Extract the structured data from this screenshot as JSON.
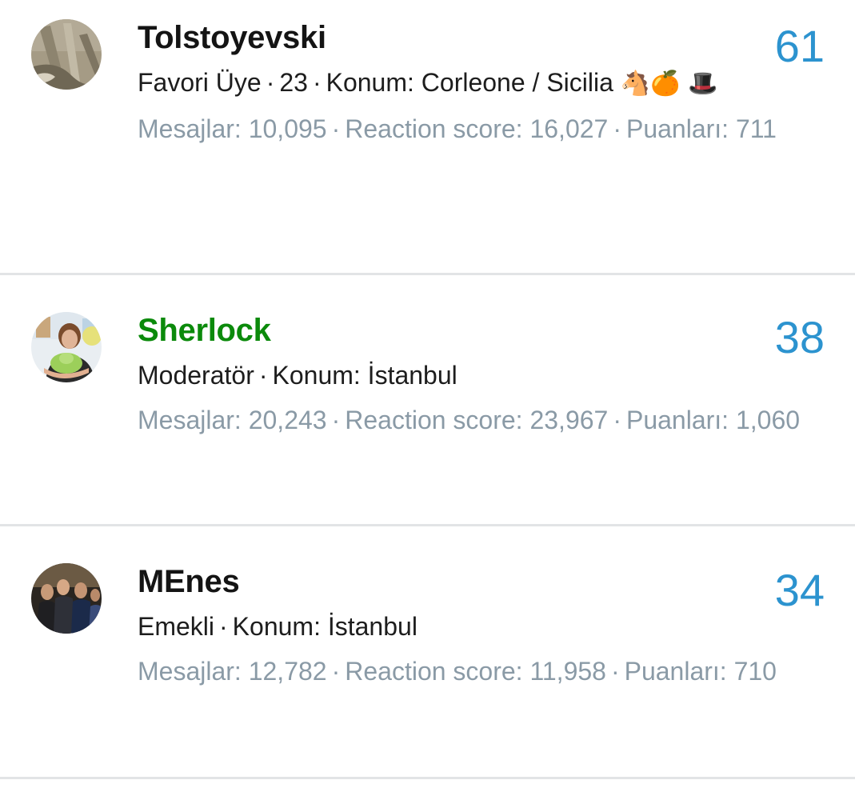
{
  "members": [
    {
      "username": "Tolstoyevski",
      "role": "Favori Üye",
      "age": "23",
      "location_label": "Konum:",
      "location": "Corleone / Sicilia",
      "location_emoji": "🐴🍊 🎩",
      "messages_label": "Mesajlar:",
      "messages": "10,095",
      "reaction_label": "Reaction score:",
      "reaction": "16,027",
      "points_label": "Puanları:",
      "points": "711",
      "score": "61",
      "username_color": "#141414"
    },
    {
      "username": "Sherlock",
      "role": "Moderatör",
      "location_label": "Konum:",
      "location": "İstanbul",
      "messages_label": "Mesajlar:",
      "messages": "20,243",
      "reaction_label": "Reaction score:",
      "reaction": "23,967",
      "points_label": "Puanları:",
      "points": "1,060",
      "score": "38",
      "username_color": "#0b8a0b"
    },
    {
      "username": "MEnes",
      "role": "Emekli",
      "location_label": "Konum:",
      "location": "İstanbul",
      "messages_label": "Mesajlar:",
      "messages": "12,782",
      "reaction_label": "Reaction score:",
      "reaction": "11,958",
      "points_label": "Puanları:",
      "points": "710",
      "score": "34",
      "username_color": "#141414"
    }
  ],
  "separator": "·",
  "colors": {
    "score": "#2c93cf",
    "stats_text": "#8a9aa6",
    "divider": "#e2e4e6",
    "moderator_name": "#0b8a0b"
  }
}
